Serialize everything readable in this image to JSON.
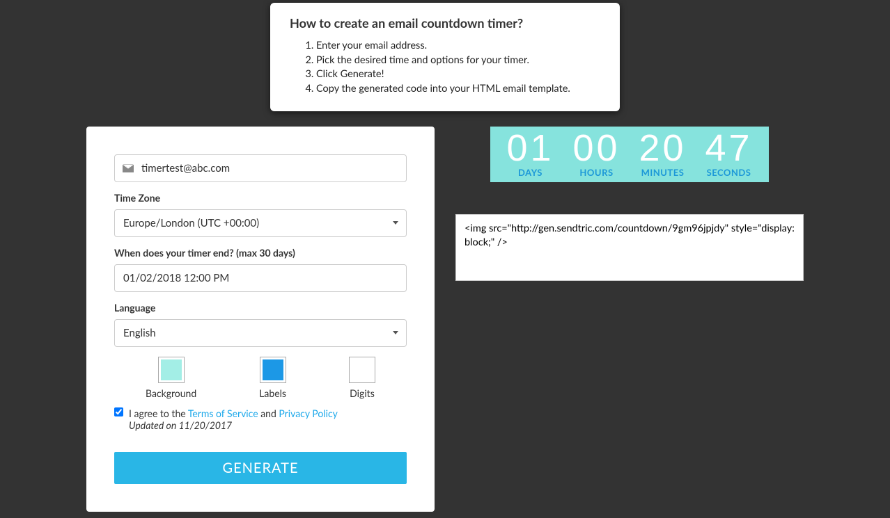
{
  "howto": {
    "title": "How to create an email countdown timer?",
    "steps": [
      "Enter your email address.",
      "Pick the desired time and options for your timer.",
      "Click Generate!",
      "Copy the generated code into your HTML email template."
    ]
  },
  "form": {
    "email_value": "timertest@abc.com",
    "timezone_label": "Time Zone",
    "timezone_value": "Europe/London (UTC +00:00)",
    "end_label": "When does your timer end? (max 30 days)",
    "end_value": "01/02/2018 12:00 PM",
    "language_label": "Language",
    "language_value": "English",
    "colors": {
      "background": {
        "label": "Background",
        "hex": "#a3eee6"
      },
      "labels": {
        "label": "Labels",
        "hex": "#1c98e6"
      },
      "digits": {
        "label": "Digits",
        "hex": "#ffffff"
      }
    },
    "agree": {
      "prefix": "I agree to the ",
      "tos": "Terms of Service",
      "and": " and ",
      "privacy": "Privacy Policy",
      "updated": "Updated on 11/20/2017"
    },
    "generate_label": "GENERATE"
  },
  "preview": {
    "days_num": "01",
    "days_label": "DAYS",
    "hours_num": "00",
    "hours_label": "HOURS",
    "minutes_num": "20",
    "minutes_label": "MINUTES",
    "seconds_num": "47",
    "seconds_label": "SECONDS"
  },
  "code": "<img src=\"http://gen.sendtric.com/countdown/9gm96jpjdy\" style=\"display: block;\" />"
}
